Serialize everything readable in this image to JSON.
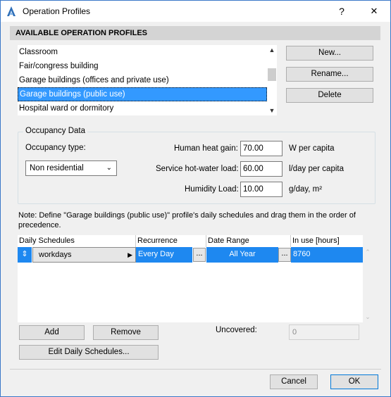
{
  "window": {
    "title": "Operation Profiles",
    "help_label": "?",
    "close_label": "✕"
  },
  "section_title": "AVAILABLE OPERATION PROFILES",
  "profiles": [
    {
      "label": "Classroom",
      "selected": false
    },
    {
      "label": "Fair/congress building",
      "selected": false
    },
    {
      "label": "Garage buildings (offices and private use)",
      "selected": false
    },
    {
      "label": "Garage buildings (public use)",
      "selected": true
    },
    {
      "label": "Hospital ward or dormitory",
      "selected": false
    }
  ],
  "profile_buttons": {
    "new": "New...",
    "rename": "Rename...",
    "delete": "Delete"
  },
  "occupancy": {
    "title": "Occupancy Data",
    "type_label": "Occupancy type:",
    "type_value": "Non residential",
    "heat_gain_label": "Human heat gain:",
    "heat_gain_value": "70.00",
    "heat_gain_unit": "W per capita",
    "hot_water_label": "Service hot-water load:",
    "hot_water_value": "60.00",
    "hot_water_unit": "l/day per capita",
    "humidity_label": "Humidity Load:",
    "humidity_value": "10.00",
    "humidity_unit": "g/day, m²"
  },
  "note": "Note: Define \"Garage buildings (public use)\" profile's daily schedules and drag them in the order of precedence.",
  "schedule_table": {
    "headers": [
      "Daily Schedules",
      "Recurrence",
      "Date Range",
      "In use [hours]"
    ],
    "rows": [
      {
        "schedule": "workdays",
        "recurrence": "Every Day",
        "date_range": "All Year",
        "hours": "8760"
      }
    ],
    "dots_label": "..."
  },
  "schedule_buttons": {
    "add": "Add",
    "remove": "Remove",
    "edit": "Edit Daily Schedules..."
  },
  "uncovered": {
    "label": "Uncovered:",
    "value": "0"
  },
  "dialog_buttons": {
    "cancel": "Cancel",
    "ok": "OK"
  },
  "colors": {
    "selection": "#3399ff",
    "row_highlight": "#1e88f0",
    "header_band": "#d4d4d4",
    "accent_border": "#0078d7"
  },
  "icons": {
    "app": "archicad-icon",
    "scroll_up": "chevron-up-icon",
    "scroll_down": "chevron-down-icon",
    "row_arrow": "triangle-right-icon",
    "drag": "updown-arrow-icon"
  }
}
